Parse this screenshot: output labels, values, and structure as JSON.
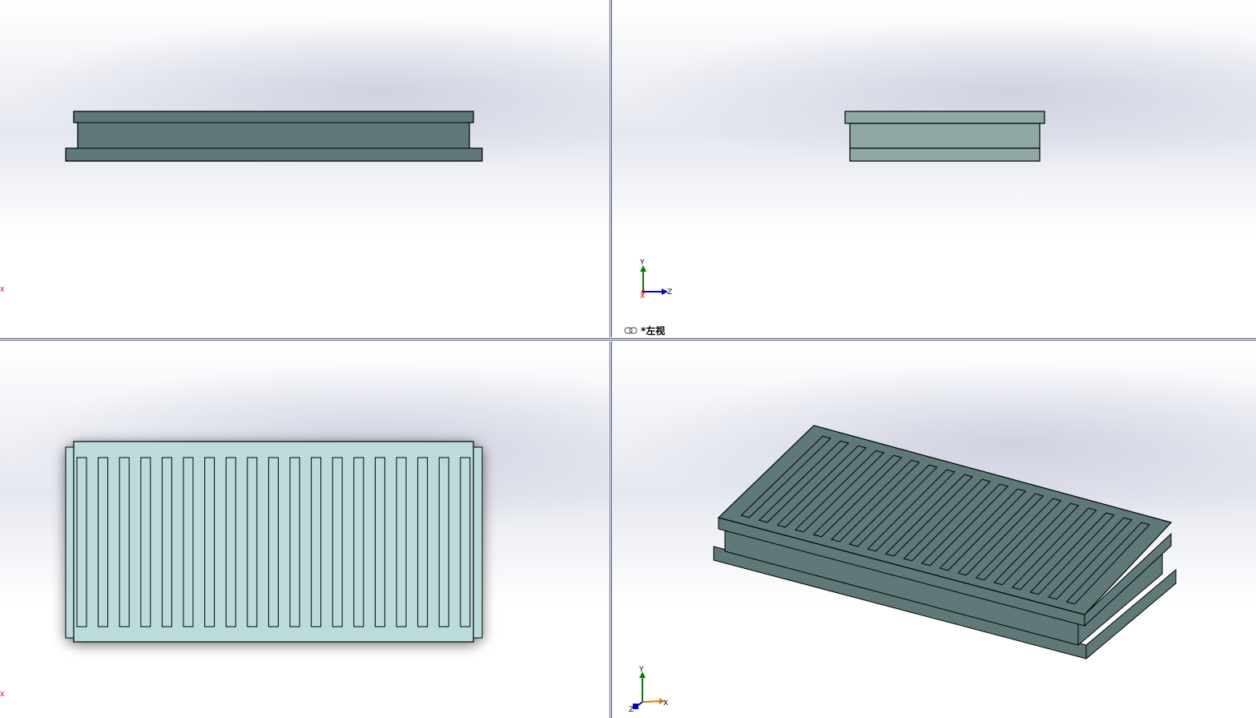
{
  "viewports": {
    "top_left": {
      "name": "front-view"
    },
    "top_right": {
      "name": "left-view",
      "view_label": "*左视",
      "triad": {
        "y": "Y",
        "z": "Z",
        "x": "X"
      }
    },
    "bottom_left": {
      "name": "top-view"
    },
    "bottom_right": {
      "name": "isometric-view",
      "triad": {
        "y": "Y",
        "z": "Z",
        "x": "X"
      }
    }
  },
  "edge_axis_marks": {
    "tl": "X",
    "bl": "X"
  },
  "colors": {
    "model_dark": "#5f7878",
    "model_mid": "#8fa8a6",
    "model_light": "#bcdcdc",
    "background_tint": "#dfe2ee",
    "divider": "#5a5f8a",
    "axis_x": "#cc0000",
    "axis_y": "#008000",
    "axis_z": "#0000cc"
  },
  "model": {
    "slot_count": 19
  }
}
